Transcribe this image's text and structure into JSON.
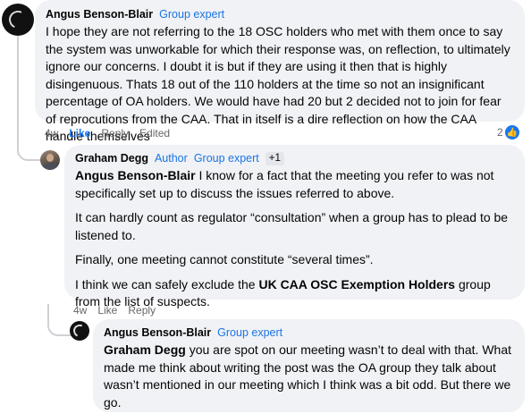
{
  "comments": [
    {
      "author": "Angus Benson-Blair",
      "badges": [
        "Group expert"
      ],
      "paragraphs": [
        "I hope they are not referring to the 18 OSC holders who met with them once to say the system was unworkable for which their response was, on reflection, to ultimately ignore our concerns. I doubt it is but if they are using it then that is highly disingenuous. Thats 18 out of the 110 holders at the time so not an insignificant percentage of OA holders. We would have had 20 but 2 decided not to join for fear of reprocutions from the CAA. That in itself is a dire reflection on how the CAA handle themselves"
      ],
      "time": "4w",
      "like_label": "Like",
      "reply_label": "Reply",
      "edited_label": "Edited",
      "reaction_count": "2",
      "reaction_icon": "thumbs-up-icon"
    },
    {
      "author": "Graham Degg",
      "badge_author": "Author",
      "badge_expert": "Group expert",
      "plus_badge": "+1",
      "mention": "Angus Benson-Blair",
      "p1_rest": " I know for a fact that the meeting you refer to was not specifically set up to discuss the issues referred to above.",
      "p2": "It can hardly count as regulator “consultation” when a group has to plead to be listened to.",
      "p3": "Finally, one meeting cannot constitute “several times”.",
      "p4_pre": "I think we can safely exclude the ",
      "p4_bold": "UK CAA OSC Exemption Holders",
      "p4_post": " group from the list of suspects.",
      "time": "4w",
      "like_label": "Like",
      "reply_label": "Reply"
    },
    {
      "author": "Angus Benson-Blair",
      "badge_expert": "Group expert",
      "mention": "Graham Degg",
      "text_rest": " you are spot on our meeting wasn’t to deal with that. What made me think about writing the post was the OA group they talk about wasn’t mentioned in our meeting which I think was a bit odd. But there we go."
    }
  ],
  "colors": {
    "bubble": "#f0f2f5",
    "link_blue": "#1877f2",
    "badge_blue": "#1b74e4",
    "meta_grey": "#65676b"
  }
}
